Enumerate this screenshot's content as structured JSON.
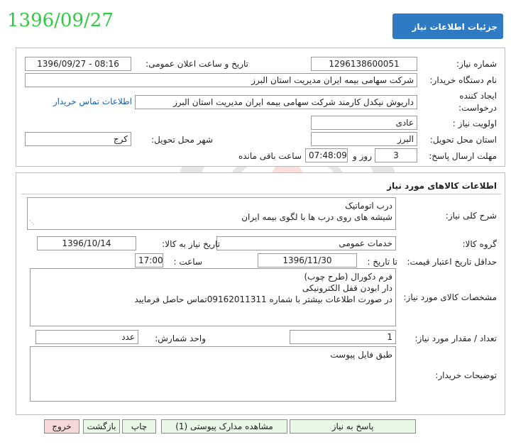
{
  "header": {
    "date_stamp": "1396/09/27",
    "title": "جزئیات اطلاعات نیاز"
  },
  "need_info": {
    "need_number_label": "شماره نیاز:",
    "need_number": "1296138600051",
    "announce_label": "تاریخ و ساعت اعلان عمومی:",
    "announce_value": "1396/09/27 - 08:16",
    "buyer_org_label": "نام دستگاه خریدار:",
    "buyer_org": "شرکت سهامی بیمه ایران مدیریت استان البرز",
    "creator_label_1": "ایجاد کننده",
    "creator_label_2": "درخواست:",
    "creator": "داریوش  نیکدل کارمند  شرکت سهامی بیمه ایران مدیریت استان البرز",
    "contact_link": "اطلاعات تماس خریدار",
    "priority_label": "اولویت نیاز :",
    "priority": "عادی",
    "province_label": "استان محل تحویل:",
    "province": "البرز",
    "city_label": "شهر محل تحویل:",
    "city": "کرج",
    "deadline_label": "مهلت ارسال پاسخ:",
    "deadline_days": "3",
    "days_word": "روز و",
    "deadline_time": "07:48:09",
    "remaining_label": "ساعت باقی مانده"
  },
  "goods": {
    "section_title": "اطلاعات کالاهای مورد نیاز",
    "summary_label": "شرح کلی نیاز:",
    "summary_lines": [
      "درب اتوماتیک",
      "شیشه های روی درب ها با لگوی بیمه ایران"
    ],
    "group_label": "گروه کالا:",
    "group": "خدمات عمومی",
    "need_date_label": "تاریخ نیاز به کالا:",
    "need_date": "1396/10/14",
    "validity_label": "حداقل تاریخ اعتبار قیمت:",
    "to_date_label": "تا تاریخ :",
    "to_date": "1396/11/30",
    "time_label": "ساعت :",
    "time": "17:00",
    "specs_label": "مشخصات کالای مورد نیاز:",
    "specs_lines": [
      "فرم دکورال (طرح چوب)",
      "دار ابودن قفل الکترونیکی",
      "در صورت اطلاعات بیشتر با شماره 09162011311تماس حاصل فرمایید"
    ],
    "qty_label": "تعداد / مقدار مورد نیاز:",
    "qty": "1",
    "unit_label": "واحد شمارش:",
    "unit": "عدد",
    "buyer_notes_label": "توضیحات خریدار:",
    "buyer_notes": "طبق فایل پیوست"
  },
  "buttons": {
    "reply": "پاسخ به نیاز",
    "attachments": "مشاهده مدارک پیوستی (1)",
    "print": "چاپ",
    "back": "بازگشت",
    "exit": "خروج"
  },
  "colors": {
    "accent": "#2e7bc4",
    "date_stamp": "#2ecc40",
    "exit_button": "#f7d8d8",
    "green_button": "#e9f7e6"
  },
  "watermark": {
    "icon": "watermark-logo-icon"
  }
}
